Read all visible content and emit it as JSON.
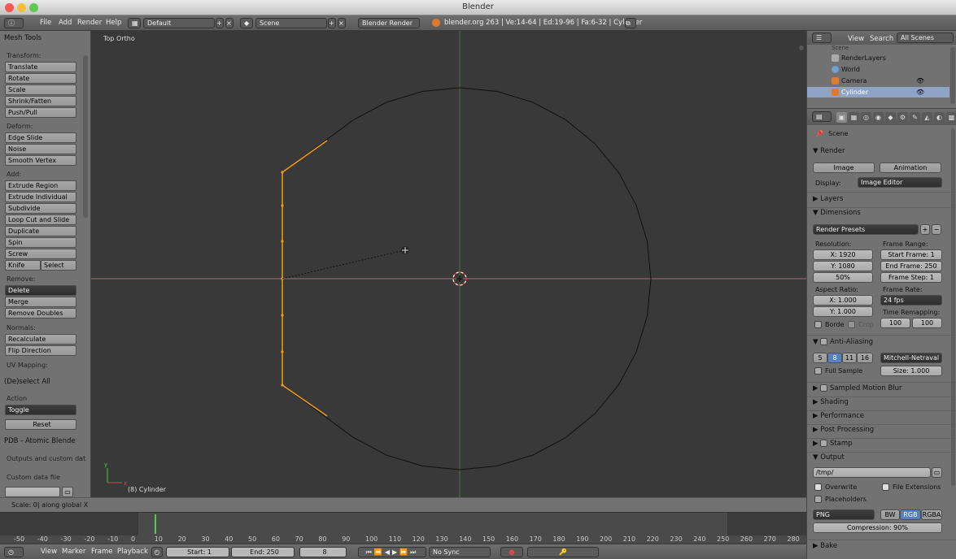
{
  "window": {
    "title": "Blender"
  },
  "menus": {
    "file": "File",
    "add": "Add",
    "render": "Render",
    "help": "Help",
    "layout": "Default",
    "scene": "Scene",
    "engine": "Blender Render",
    "stats": "blender.org 263 | Ve:14-64 | Ed:19-96 | Fa:6-32 | Cylinder"
  },
  "tools": {
    "header": "Mesh Tools",
    "transform_label": "Transform:",
    "translate": "Translate",
    "rotate": "Rotate",
    "scale": "Scale",
    "shrink": "Shrink/Fatten",
    "push": "Push/Pull",
    "deform_label": "Deform:",
    "edge_slide": "Edge Slide",
    "noise": "Noise",
    "smooth_vertex": "Smooth Vertex",
    "add_label": "Add:",
    "extrude_region": "Extrude Region",
    "extrude_individual": "Extrude Individual",
    "subdivide": "Subdivide",
    "loop_cut": "Loop Cut and Slide",
    "duplicate": "Duplicate",
    "spin": "Spin",
    "screw": "Screw",
    "knife": "Knife",
    "select": "Select",
    "remove_label": "Remove:",
    "delete": "Delete",
    "merge": "Merge",
    "remove_doubles": "Remove Doubles",
    "normals_label": "Normals:",
    "recalculate": "Recalculate",
    "flip": "Flip Direction",
    "uv_label": "UV Mapping:",
    "deselect_header": "(De)select All",
    "action_label": "Action",
    "toggle": "Toggle",
    "reset": "Reset",
    "pdb_header": "PDB - Atomic Blende",
    "pdb_text": "Outputs and custom dat",
    "custom_file": "Custom data file"
  },
  "viewport": {
    "view_name": "Top Ortho",
    "object_label": "(8) Cylinder",
    "axis_y": "y",
    "axis_x": "x"
  },
  "status": {
    "text": "Scale: 0| along global X"
  },
  "timeline": {
    "ticks": [
      "-50",
      "-40",
      "-30",
      "-20",
      "-10",
      "0",
      "10",
      "20",
      "30",
      "40",
      "50",
      "60",
      "70",
      "80",
      "90",
      "100",
      "110",
      "120",
      "130",
      "140",
      "150",
      "160",
      "170",
      "180",
      "190",
      "200",
      "210",
      "220",
      "230",
      "240",
      "250",
      "260",
      "270",
      "280"
    ]
  },
  "bottom": {
    "view": "View",
    "marker": "Marker",
    "frame": "Frame",
    "playback": "Playback",
    "start": "Start: 1",
    "end": "End: 250",
    "current": "8",
    "sync": "No Sync"
  },
  "outliner": {
    "view": "View",
    "search": "Search",
    "scenes": "All Scenes",
    "scene": "Scene",
    "render_layers": "RenderLayers",
    "world": "World",
    "camera": "Camera",
    "cylinder": "Cylinder"
  },
  "props": {
    "scene": "Scene",
    "render": "Render",
    "image": "Image",
    "animation": "Animation",
    "display_label": "Display:",
    "display": "Image Editor",
    "layers": "Layers",
    "dimensions": "Dimensions",
    "presets": "Render Presets",
    "resolution_label": "Resolution:",
    "res_x": "X: 1920",
    "res_y": "Y: 1080",
    "res_pct": "50%",
    "frame_range_label": "Frame Range:",
    "start_frame": "Start Frame: 1",
    "end_frame": "End Frame: 250",
    "frame_step": "Frame Step: 1",
    "aspect_label": "Aspect Ratio:",
    "aspect_x": "X: 1.000",
    "aspect_y": "Y: 1.000",
    "frame_rate_label": "Frame Rate:",
    "fps": "24 fps",
    "time_remap_label": "Time Remapping:",
    "remap_old": "100",
    "remap_new": "100",
    "border": "Borde",
    "crop": "Crop",
    "anti_aliasing": "Anti-Aliasing",
    "aa5": "5",
    "aa8": "8",
    "aa11": "11",
    "aa16": "16",
    "filter": "Mitchell-Netraval",
    "full_sample": "Full Sample",
    "size": "Size: 1.000",
    "motion_blur": "Sampled Motion Blur",
    "shading": "Shading",
    "performance": "Performance",
    "post": "Post Processing",
    "stamp": "Stamp",
    "output": "Output",
    "path": "/tmp/",
    "overwrite": "Overwrite",
    "file_ext": "File Extensions",
    "placeholders": "Placeholders",
    "format": "PNG",
    "bw": "BW",
    "rgb": "RGB",
    "rgba": "RGBA",
    "compression": "Compression: 90%",
    "bake": "Bake"
  },
  "colors": {
    "accent": "#5680c2",
    "viewport": "#393939",
    "selected": "#f39c12"
  }
}
